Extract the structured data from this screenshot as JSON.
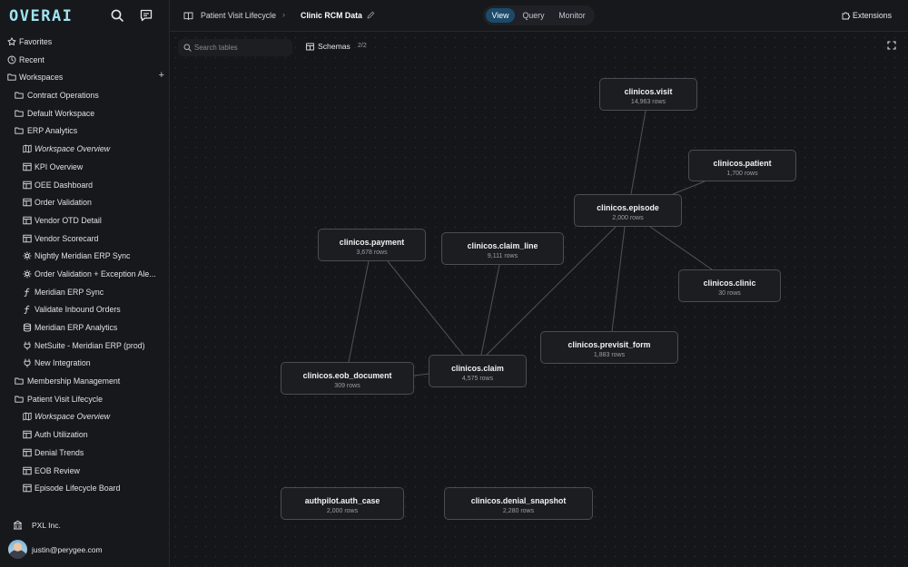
{
  "brand": {
    "logo": "OVERAI"
  },
  "sidebar": {
    "favorites": "Favorites",
    "recent": "Recent",
    "workspaces": "Workspaces",
    "items": [
      {
        "label": "Contract Operations",
        "level": 1,
        "icon": "folder-icon"
      },
      {
        "label": "Default Workspace",
        "level": 1,
        "icon": "folder-icon"
      },
      {
        "label": "ERP Analytics",
        "level": 1,
        "icon": "folder-icon"
      },
      {
        "label": "Workspace Overview",
        "level": 2,
        "icon": "map-icon",
        "italic": true
      },
      {
        "label": "KPI Overview",
        "level": 2,
        "icon": "dashboard-icon"
      },
      {
        "label": "OEE Dashboard",
        "level": 2,
        "icon": "dashboard-icon"
      },
      {
        "label": "Order Validation",
        "level": 2,
        "icon": "dashboard-icon"
      },
      {
        "label": "Vendor OTD Detail",
        "level": 2,
        "icon": "dashboard-icon"
      },
      {
        "label": "Vendor Scorecard",
        "level": 2,
        "icon": "dashboard-icon"
      },
      {
        "label": "Nightly Meridian ERP Sync",
        "level": 2,
        "icon": "schedule-icon"
      },
      {
        "label": "Order Validation + Exception Ale...",
        "level": 2,
        "icon": "schedule-icon"
      },
      {
        "label": "Meridian ERP Sync",
        "level": 2,
        "icon": "function-icon"
      },
      {
        "label": "Validate Inbound Orders",
        "level": 2,
        "icon": "function-icon"
      },
      {
        "label": "Meridian ERP Analytics",
        "level": 2,
        "icon": "database-icon"
      },
      {
        "label": "NetSuite - Meridian ERP (prod)",
        "level": 2,
        "icon": "plug-icon"
      },
      {
        "label": "New Integration",
        "level": 2,
        "icon": "plug-icon"
      },
      {
        "label": "Membership Management",
        "level": 1,
        "icon": "folder-icon"
      },
      {
        "label": "Patient Visit Lifecycle",
        "level": 1,
        "icon": "folder-icon"
      },
      {
        "label": "Workspace Overview",
        "level": 2,
        "icon": "map-icon",
        "italic": true
      },
      {
        "label": "Auth Utilization",
        "level": 2,
        "icon": "dashboard-icon"
      },
      {
        "label": "Denial Trends",
        "level": 2,
        "icon": "dashboard-icon"
      },
      {
        "label": "EOB Review",
        "level": 2,
        "icon": "dashboard-icon"
      },
      {
        "label": "Episode Lifecycle Board",
        "level": 2,
        "icon": "dashboard-icon"
      }
    ],
    "org": "PXL Inc.",
    "user_email": "justin@perygee.com"
  },
  "header": {
    "breadcrumb_parent": "Patient Visit Lifecycle",
    "breadcrumb_separator": "›",
    "title": "Clinic RCM Data",
    "tabs": [
      "View",
      "Query",
      "Monitor"
    ],
    "active_tab": "View",
    "extensions_label": "Extensions"
  },
  "toolbar": {
    "search_placeholder": "Search tables",
    "schemas_label": "Schemas",
    "schemas_count": "2/2"
  },
  "graph": {
    "nodes": [
      {
        "id": "visit",
        "name": "clinicos.visit",
        "rows": "14,963 rows"
      },
      {
        "id": "patient",
        "name": "clinicos.patient",
        "rows": "1,700 rows"
      },
      {
        "id": "episode",
        "name": "clinicos.episode",
        "rows": "2,000 rows"
      },
      {
        "id": "payment",
        "name": "clinicos.payment",
        "rows": "3,678 rows"
      },
      {
        "id": "claim_line",
        "name": "clinicos.claim_line",
        "rows": "9,111 rows"
      },
      {
        "id": "clinic",
        "name": "clinicos.clinic",
        "rows": "30 rows"
      },
      {
        "id": "previsit_form",
        "name": "clinicos.previsit_form",
        "rows": "1,883 rows"
      },
      {
        "id": "eob_document",
        "name": "clinicos.eob_document",
        "rows": "309 rows"
      },
      {
        "id": "claim",
        "name": "clinicos.claim",
        "rows": "4,575 rows"
      },
      {
        "id": "auth_case",
        "name": "authpilot.auth_case",
        "rows": "2,000 rows"
      },
      {
        "id": "denial_snapshot",
        "name": "clinicos.denial_snapshot",
        "rows": "2,280 rows"
      }
    ],
    "edges": [
      [
        "visit",
        "episode"
      ],
      [
        "patient",
        "episode"
      ],
      [
        "episode",
        "clinic"
      ],
      [
        "episode",
        "claim"
      ],
      [
        "episode",
        "previsit_form"
      ],
      [
        "payment",
        "claim"
      ],
      [
        "payment",
        "eob_document"
      ],
      [
        "claim_line",
        "claim"
      ],
      [
        "eob_document",
        "claim"
      ]
    ]
  }
}
